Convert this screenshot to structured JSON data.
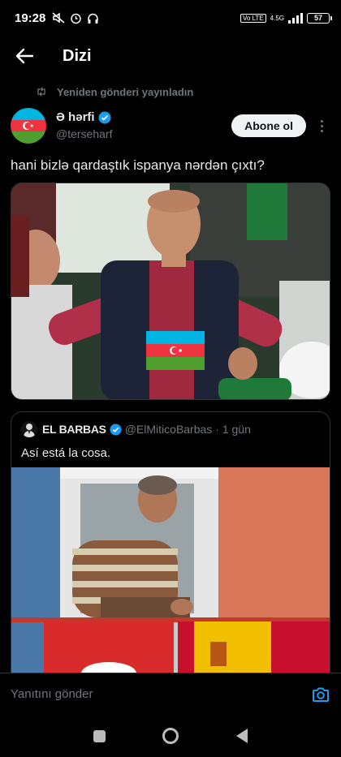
{
  "status_bar": {
    "time": "19:28",
    "network_tag": "Vo LTE",
    "network_type": "4.5G",
    "battery": "57"
  },
  "header": {
    "title": "Dizi"
  },
  "tweet": {
    "retweet_label": "Yeniden gönderi yayınladın",
    "author_name": "Ə hərfi",
    "author_handle": "@terseharf",
    "follow_label": "Abone ol",
    "text": "hani bizlə qardaştık ispanya nərdən çıxtı?"
  },
  "quote": {
    "author_name": "EL BARBAS",
    "author_handle": "@ElMiticoBarbas",
    "time": "· 1 gün",
    "text": "Así está la cosa."
  },
  "reply": {
    "placeholder": "Yanıtını gönder"
  },
  "colors": {
    "verified": "#1d9bf0",
    "az_blue": "#00b5e2",
    "az_red": "#ef3340",
    "az_green": "#509e2f"
  }
}
